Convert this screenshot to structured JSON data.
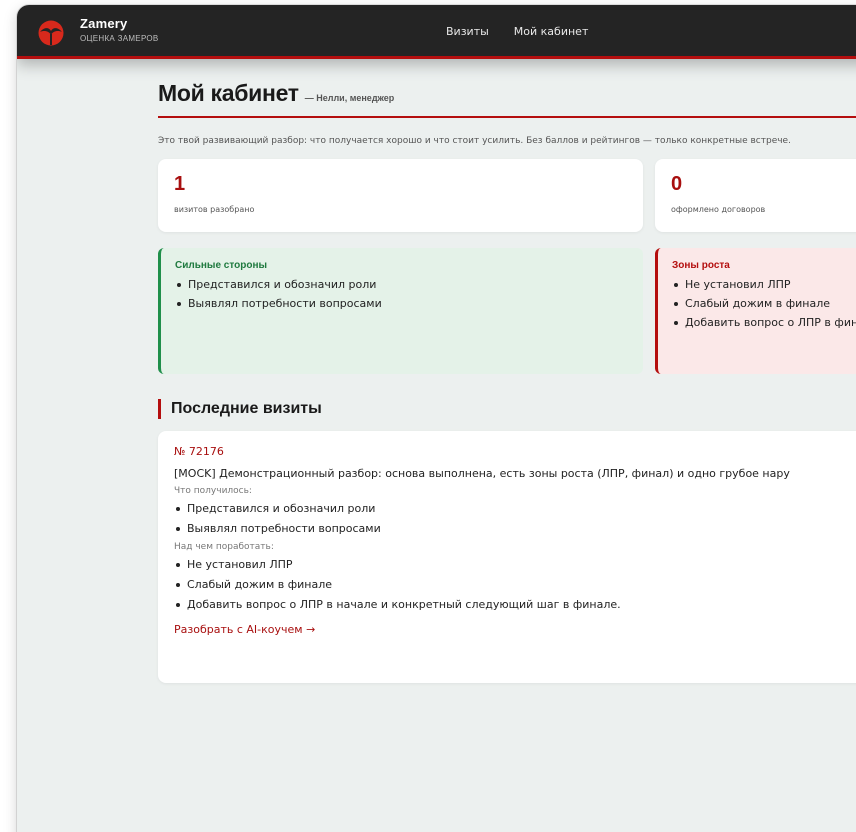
{
  "header": {
    "brand": "Zamery",
    "tagline": "ОЦЕНКА ЗАМЕРОВ",
    "nav": [
      "Визиты",
      "Мой кабинет"
    ]
  },
  "page": {
    "title": "Мой кабинет",
    "subtitle": "— Нелли, менеджер",
    "intro": "Это твой развивающий разбор: что получается хорошо и что стоит усилить. Без баллов и рейтингов — только конкретные встрече."
  },
  "stats": [
    {
      "value": "1",
      "label": "визитов разобрано"
    },
    {
      "value": "0",
      "label": "оформлено договоров"
    }
  ],
  "strengths": {
    "title": "Сильные стороны",
    "items": [
      "Представился и обозначил роли",
      "Выявлял потребности вопросами"
    ]
  },
  "growth": {
    "title": "Зоны роста",
    "items": [
      "Не установил ЛПР",
      "Слабый дожим в финале",
      "Добавить вопрос о ЛПР в финале."
    ]
  },
  "recent": {
    "title": "Последние визиты",
    "visit": {
      "number": "№ 72176",
      "description": "[MOCK] Демонстрационный разбор: основа выполнена, есть зоны роста (ЛПР, финал) и одно грубое нару",
      "good_label": "Что получилось:",
      "good_items": [
        "Представился и обозначил роли",
        "Выявлял потребности вопросами"
      ],
      "work_label": "Над чем поработать:",
      "work_items": [
        "Не установил ЛПР",
        "Слабый дожим в финале",
        "Добавить вопрос о ЛПР в начале и конкретный следующий шаг в финале."
      ],
      "link": "Разобрать с AI-коучем →"
    }
  },
  "colors": {
    "accent": "#b40e0e",
    "header_bg": "#242424",
    "page_bg": "#ecf0ef",
    "success": "#1f8f4a"
  }
}
